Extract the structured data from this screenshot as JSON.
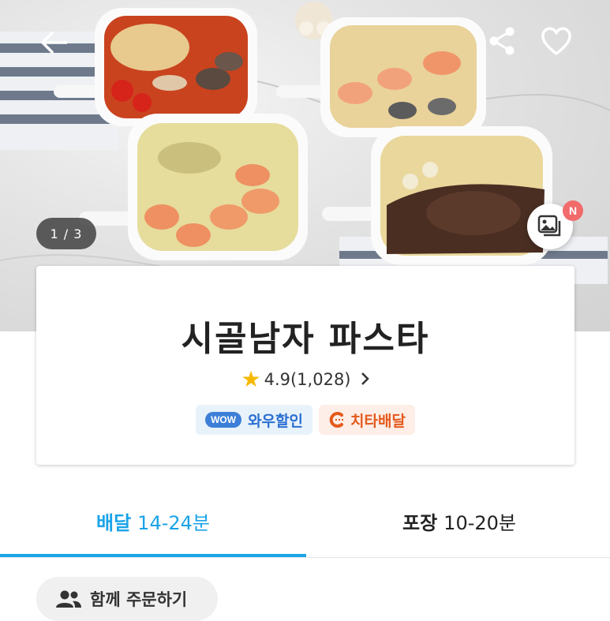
{
  "hero": {
    "pager": "1 / 3",
    "photo_badge": "N"
  },
  "store": {
    "name": "시골남자 파스타",
    "rating": "4.9(1,028)",
    "tags": [
      {
        "label": "와우할인",
        "badge": "WOW"
      },
      {
        "label": "치타배달"
      }
    ]
  },
  "tabs": {
    "delivery": {
      "label": "배달",
      "time": "14-24분"
    },
    "pickup": {
      "label": "포장",
      "time": "10-20분"
    }
  },
  "group_order": {
    "label": "함께 주문하기"
  },
  "colors": {
    "accent": "#1aa3e8",
    "star": "#f6b800",
    "wow_blue": "#3d7fd8",
    "cheetah_orange": "#e45a1c",
    "badge_red": "#f26b6b"
  },
  "icons": [
    "back-arrow-icon",
    "share-icon",
    "heart-icon",
    "photo-review-icon",
    "star-icon",
    "chevron-right-icon",
    "people-icon"
  ]
}
